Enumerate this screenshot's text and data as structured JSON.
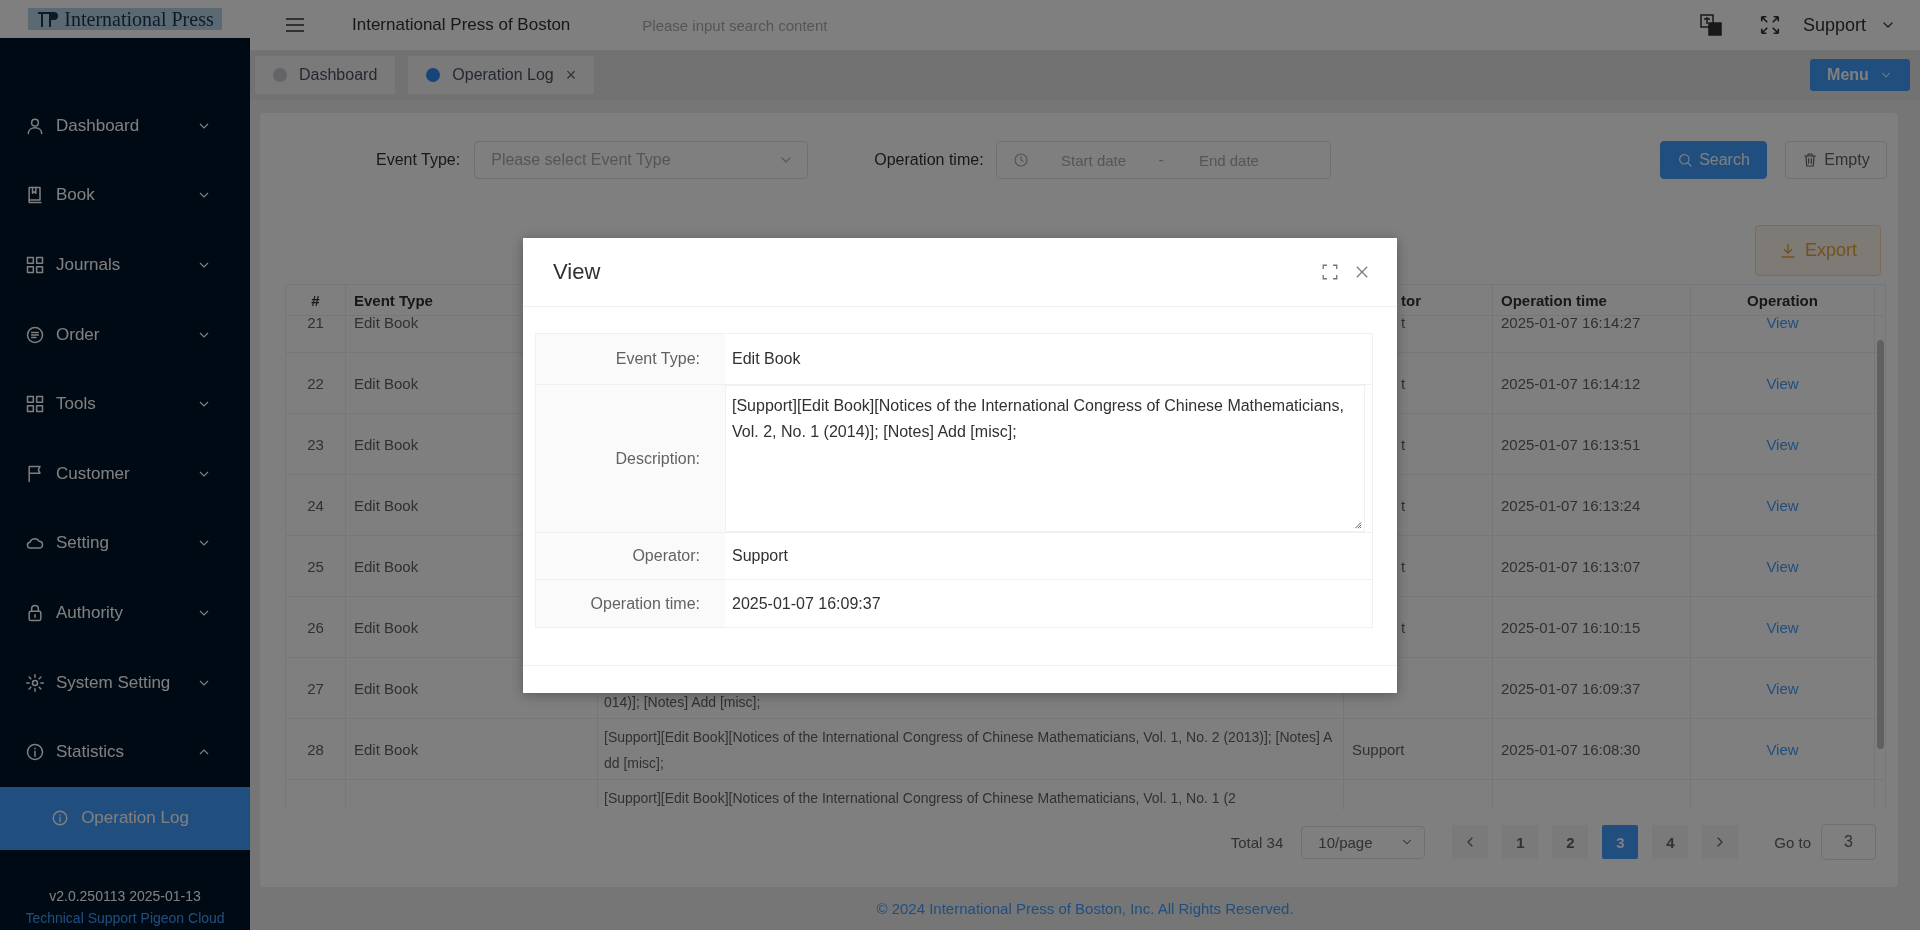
{
  "logo": {
    "text": "International Press"
  },
  "sidebar": {
    "items": [
      {
        "label": "Dashboard",
        "expanded": false
      },
      {
        "label": "Book",
        "expanded": false
      },
      {
        "label": "Journals",
        "expanded": false
      },
      {
        "label": "Order",
        "expanded": false
      },
      {
        "label": "Tools",
        "expanded": false
      },
      {
        "label": "Customer",
        "expanded": false
      },
      {
        "label": "Setting",
        "expanded": false
      },
      {
        "label": "Authority",
        "expanded": false
      },
      {
        "label": "System Setting",
        "expanded": false
      },
      {
        "label": "Statistics",
        "expanded": true,
        "children": [
          {
            "label": "Operation Log",
            "selected": true
          }
        ]
      }
    ],
    "version": "v2.0.250113 2025-01-13",
    "support_link": "Technical Support Pigeon Cloud"
  },
  "header": {
    "title": "International Press of Boston",
    "search": {
      "placeholder": "Please input search content"
    },
    "user": "Support"
  },
  "tabs": [
    {
      "label": "Dashboard",
      "selected": false
    },
    {
      "label": "Operation Log",
      "selected": true,
      "close": "×"
    }
  ],
  "menu_button": "Menu",
  "filters": {
    "event_type": {
      "label": "Event Type:",
      "placeholder": "Please select Event Type"
    },
    "operation_time": {
      "label": "Operation time:",
      "start_placeholder": "Start date",
      "separator": "-",
      "end_placeholder": "End date"
    },
    "buttons": [
      {
        "label": "Search",
        "kind": "primary"
      },
      {
        "label": "Empty",
        "kind": "plain"
      }
    ]
  },
  "export_button": "Export",
  "table": {
    "columns": [
      {
        "label": "#"
      },
      {
        "label": "Event Type"
      },
      {},
      {
        "label": "tor",
        "clipped": true
      },
      {
        "label": "Operation time"
      },
      {
        "label": "Operation"
      }
    ],
    "rows": [
      {
        "no": "21",
        "event_type": "Edit Book",
        "operator": "t",
        "operator_clipped": true,
        "time": "2025-01-07 16:14:27",
        "action": "View"
      },
      {
        "no": "22",
        "event_type": "Edit Book",
        "operator": "t",
        "operator_clipped": true,
        "time": "2025-01-07 16:14:12",
        "action": "View"
      },
      {
        "no": "23",
        "event_type": "Edit Book",
        "operator": "t",
        "operator_clipped": true,
        "time": "2025-01-07 16:13:51",
        "action": "View"
      },
      {
        "no": "24",
        "event_type": "Edit Book",
        "operator": "t",
        "operator_clipped": true,
        "time": "2025-01-07 16:13:24",
        "action": "View"
      },
      {
        "no": "25",
        "event_type": "Edit Book",
        "operator": "t",
        "operator_clipped": true,
        "time": "2025-01-07 16:13:07",
        "action": "View"
      },
      {
        "no": "26",
        "event_type": "Edit Book",
        "operator": "t",
        "operator_clipped": true,
        "time": "2025-01-07 16:10:15",
        "action": "View"
      },
      {
        "no": "27",
        "event_type": "Edit Book",
        "description": "014)]; [Notes] Add [misc];",
        "description_clipped": true,
        "time": "2025-01-07 16:09:37",
        "action": "View"
      },
      {
        "no": "28",
        "event_type": "Edit Book",
        "description": "[Support][Edit Book][Notices of the International Congress of Chinese Mathematicians, Vol. 1, No. 2 (2013)]; [Notes] Add [misc];",
        "operator": "Support",
        "time": "2025-01-07 16:08:30",
        "action": "View"
      },
      {
        "description": "[Support][Edit Book][Notices of the International Congress of Chinese Mathematicians, Vol. 1, No. 1 (2"
      }
    ]
  },
  "pagination": {
    "total": "Total 34",
    "page_size": "10/page",
    "pages": [
      {
        "label": "1",
        "selected": false
      },
      {
        "label": "2",
        "selected": false
      },
      {
        "label": "3",
        "selected": true
      },
      {
        "label": "4",
        "selected": false
      }
    ],
    "goto_label": "Go to",
    "goto_value": "3"
  },
  "footer": "© 2024 International Press of Boston, Inc. All Rights Reserved.",
  "modal": {
    "title": "View",
    "fields": [
      {
        "label": "Event Type:",
        "value": "Edit Book",
        "kind": "text"
      },
      {
        "label": "Description:",
        "value": "[Support][Edit Book][Notices of the International Congress of Chinese Mathematicians, Vol. 2, No. 1 (2014)]; [Notes] Add [misc];",
        "kind": "textarea"
      },
      {
        "label": "Operator:",
        "value": "Support",
        "kind": "text"
      },
      {
        "label": "Operation time:",
        "value": "2025-01-07 16:09:37",
        "kind": "text"
      }
    ]
  }
}
